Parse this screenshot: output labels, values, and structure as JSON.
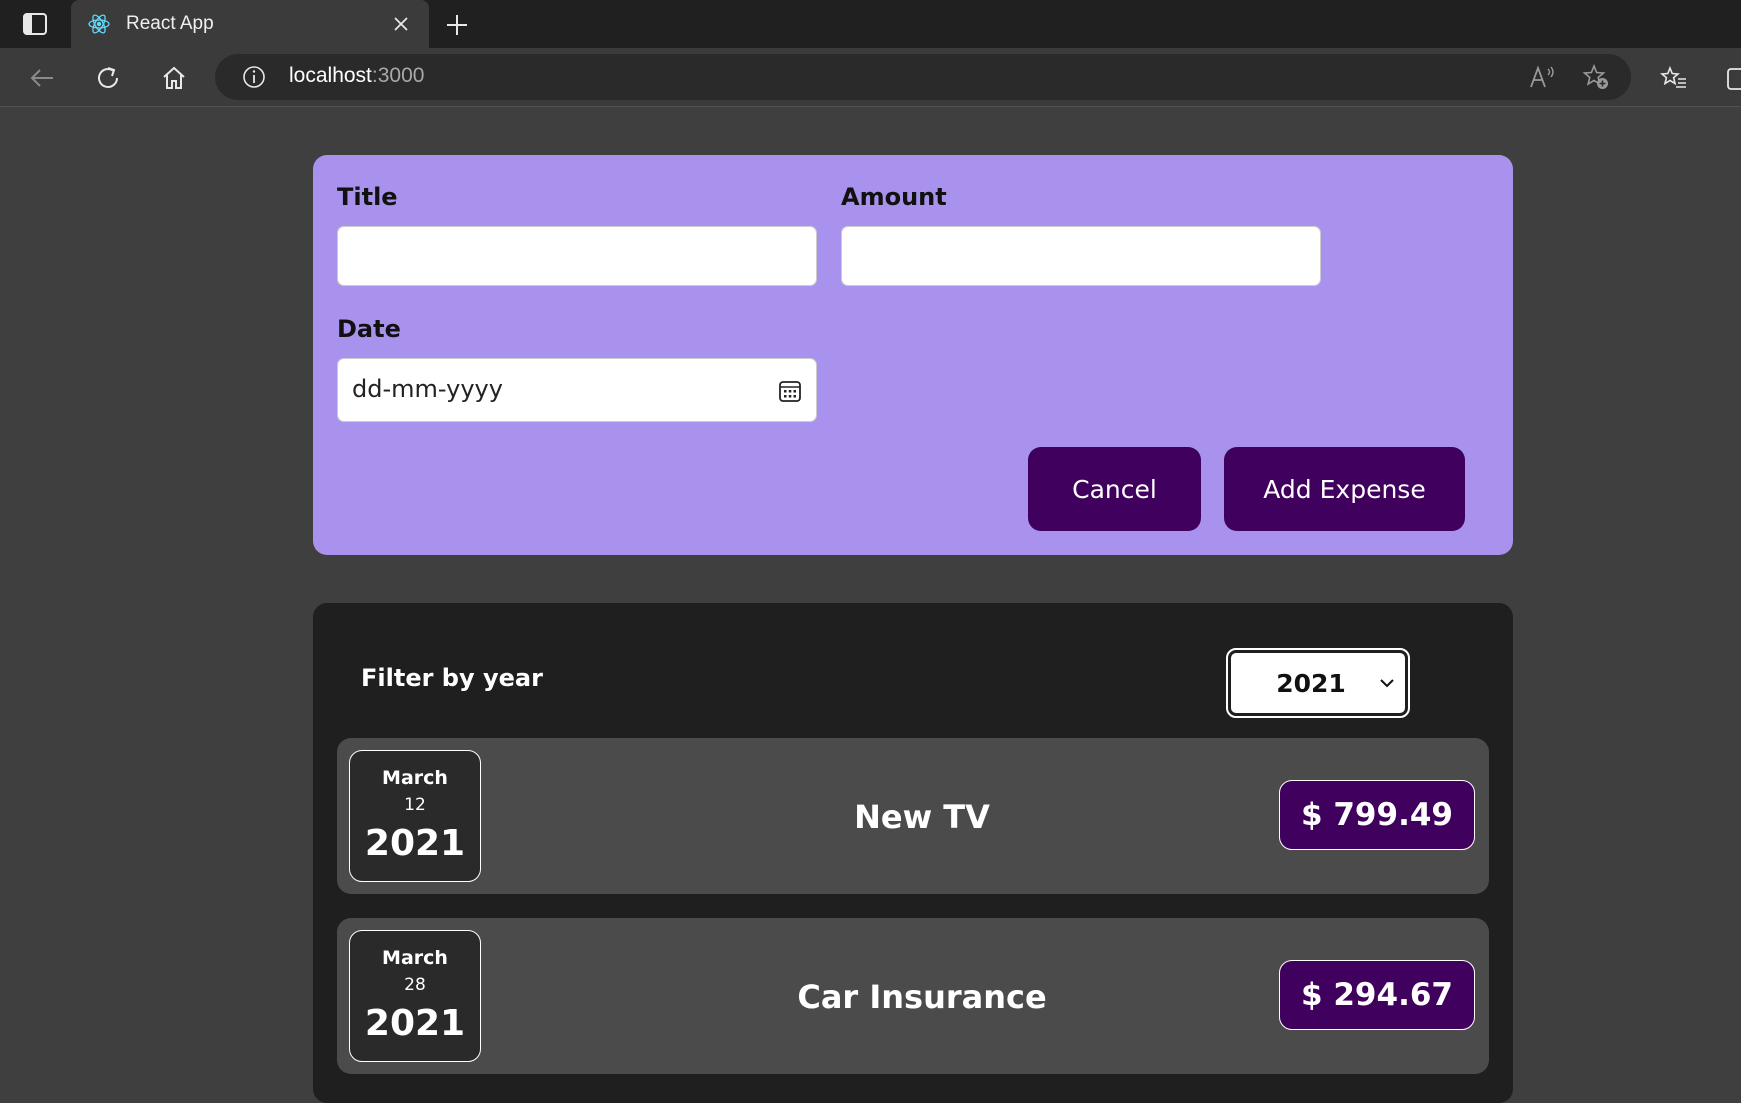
{
  "browser": {
    "tab_title": "React App",
    "url_host": "localhost",
    "url_port": ":3000"
  },
  "form": {
    "title_label": "Title",
    "title_value": "",
    "amount_label": "Amount",
    "amount_value": "",
    "date_label": "Date",
    "date_placeholder": "dd-mm-yyyy",
    "cancel_label": "Cancel",
    "add_label": "Add Expense"
  },
  "filter": {
    "label": "Filter by year",
    "selected_year": "2021"
  },
  "expenses": [
    {
      "month": "March",
      "day": "12",
      "year": "2021",
      "title": "New TV",
      "amount": "$ 799.49"
    },
    {
      "month": "March",
      "day": "28",
      "year": "2021",
      "title": "Car Insurance",
      "amount": "$ 294.67"
    }
  ],
  "colors": {
    "form_bg": "#a892ee",
    "button_bg": "#40005d",
    "card_bg": "#1f1f1f",
    "item_bg": "#4b4b4b"
  }
}
